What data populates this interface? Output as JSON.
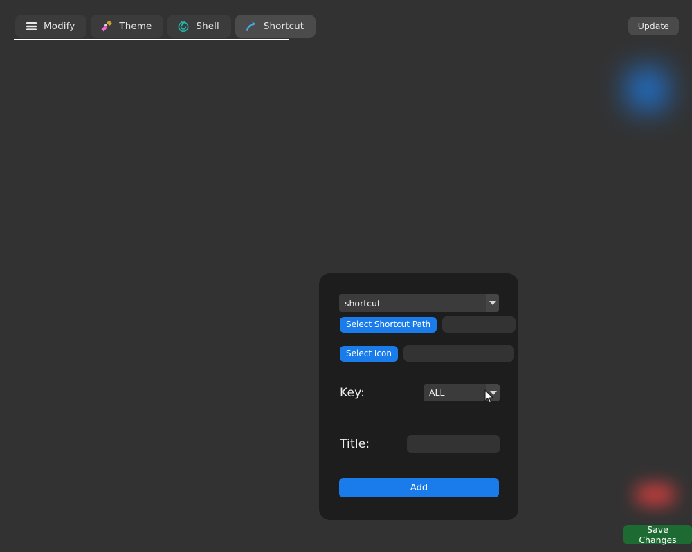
{
  "window": {
    "background_color": "#323232",
    "panel_color": "#1d1d1d",
    "accent_blue": "#1a7ceb",
    "accent_green": "#1d6b33",
    "glow_blue": "#1f7ae0",
    "glow_red": "#d84040"
  },
  "tabbar": {
    "tabs": [
      {
        "label": "Modify",
        "icon": "hamburger-menu-icon",
        "active": false
      },
      {
        "label": "Theme",
        "icon": "paintbrush-icon",
        "active": false
      },
      {
        "label": "Shell",
        "icon": "shell-spiral-icon",
        "active": false
      },
      {
        "label": "Shortcut",
        "icon": "curved-arrow-icon",
        "active": true
      }
    ],
    "update_label": "Update"
  },
  "form": {
    "type_select": {
      "value": "shortcut",
      "options": [
        "shortcut"
      ]
    },
    "shortcut_path": {
      "button_label": "Select Shortcut Path",
      "value": "",
      "placeholder": ""
    },
    "icon": {
      "button_label": "Select Icon",
      "value": "",
      "placeholder": ""
    },
    "key": {
      "label": "Key:",
      "value": "ALL",
      "options": [
        "ALL"
      ]
    },
    "title": {
      "label": "Title:",
      "value": "",
      "placeholder": ""
    },
    "add_label": "Add"
  },
  "footer": {
    "save_label": "Save Changes"
  }
}
